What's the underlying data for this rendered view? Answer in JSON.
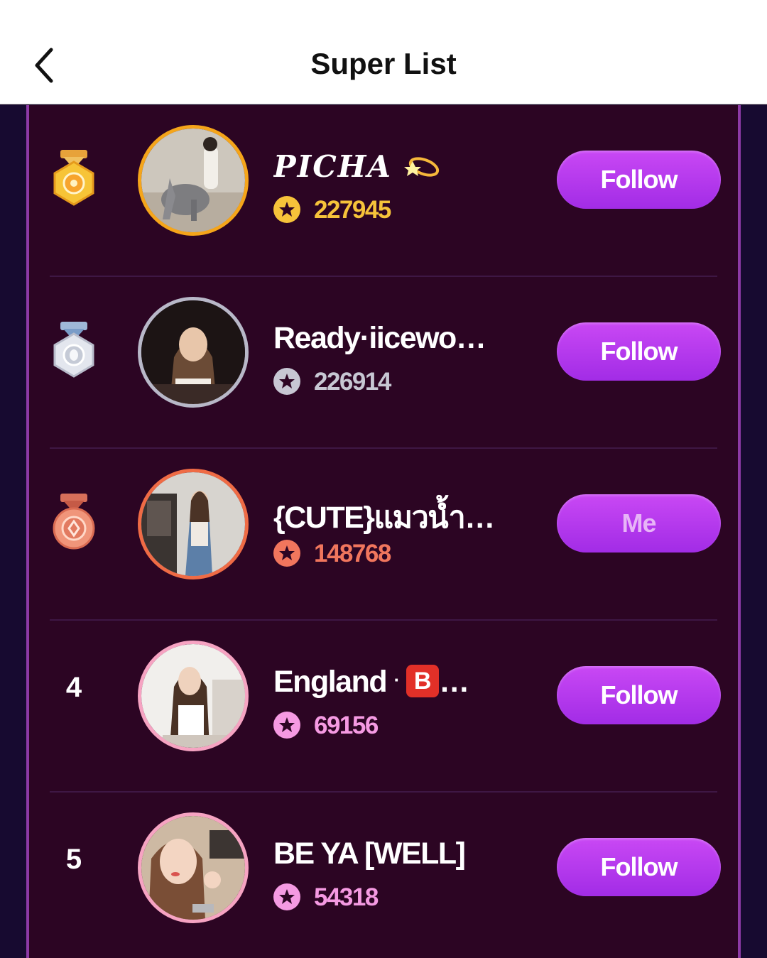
{
  "header": {
    "title": "Super List",
    "back_icon": "chevron-left-icon"
  },
  "rows": [
    {
      "rank": "1",
      "rank_icon": "gold-medal-icon",
      "name": "PICHA",
      "name_emoji": "comet-ring-icon",
      "score": "227945",
      "score_color": "#f6c33a",
      "ring_color": "#f5a51a",
      "button_label": "Follow"
    },
    {
      "rank": "2",
      "rank_icon": "silver-medal-icon",
      "name": "Ready·iicewo…",
      "score": "226914",
      "score_color": "#c7c7d3",
      "ring_color": "#b8b8c8",
      "button_label": "Follow"
    },
    {
      "rank": "3",
      "rank_icon": "bronze-medal-icon",
      "name": "{CUTE}แมวน้ำ…",
      "score": "148768",
      "score_color": "#f1765d",
      "ring_color": "#ef6b45",
      "button_label": "Me"
    },
    {
      "rank": "4",
      "name_prefix": "England",
      "name_sep": "·",
      "name_badge": "B",
      "name_suffix": "…",
      "score": "69156",
      "score_color": "#f59ae2",
      "ring_color": "#f6a3c2",
      "button_label": "Follow"
    },
    {
      "rank": "5",
      "name": "BE YA [WELL]",
      "score": "54318",
      "score_color": "#f59ae2",
      "ring_color": "#f6a3c2",
      "button_label": "Follow"
    }
  ]
}
